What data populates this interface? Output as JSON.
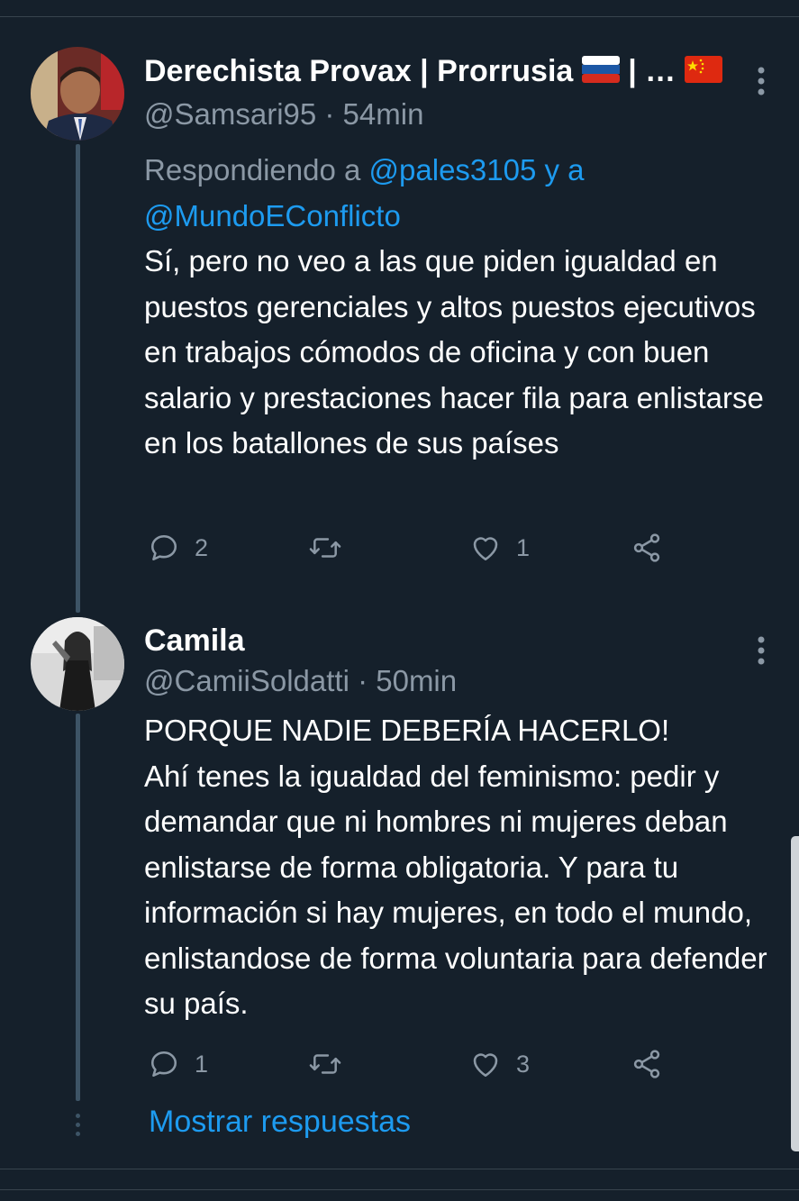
{
  "tweet1": {
    "name": "Derechista Provax | Prorrusia",
    "name_suffix": "| …",
    "handle_time": "@Samsari95 · 54min",
    "replying_prefix": "Respondiendo a ",
    "replying_mention1": "@pales3105",
    "replying_conjunction": " y a",
    "replying_mention2": "@MundoEConflicto",
    "text": "Sí, pero no veo a las que piden igualdad en puestos gerenciales y altos puestos ejecutivos en trabajos cómodos de oficina y con buen salario y prestaciones hacer fila para enlistarse en los batallones de sus países",
    "reply_count": "2",
    "retweet_count": "",
    "like_count": "1"
  },
  "tweet2": {
    "name": "Camila",
    "handle_time": "@CamiiSoldatti · 50min",
    "text_line1": "PORQUE NADIE DEBERÍA HACERLO!",
    "text": "Ahí tenes la igualdad del feminismo: pedir y demandar que ni hombres ni mujeres deban enlistarse de forma obligatoria. Y para tu información si hay mujeres, en todo el mundo, enlistandose de forma voluntaria para defender su país.",
    "reply_count": "1",
    "retweet_count": "",
    "like_count": "3"
  },
  "show_replies_label": "Mostrar respuestas",
  "colors": {
    "background": "#15202b",
    "accent": "#1d9bf0",
    "muted": "#8b98a5",
    "thread_line": "#3d5466"
  },
  "icons": [
    "reply-icon",
    "retweet-icon",
    "like-icon",
    "share-icon",
    "more-icon",
    "russia-flag-icon",
    "china-flag-icon"
  ]
}
